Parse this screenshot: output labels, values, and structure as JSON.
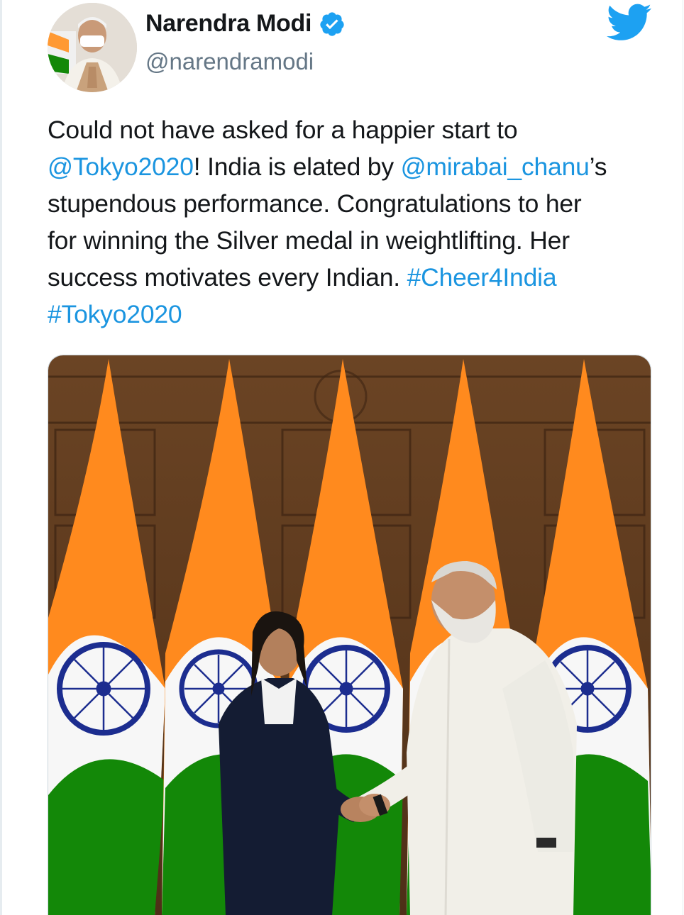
{
  "author": {
    "name": "Narendra Modi",
    "handle": "@narendramodi"
  },
  "icons": {
    "verified": "verified-badge-icon",
    "brand": "twitter-bird-icon"
  },
  "tweet": {
    "segments": [
      {
        "text": "Could not have asked for a happier start to",
        "type": "text",
        "line": 1
      },
      {
        "text": "@Tokyo2020",
        "type": "mention",
        "line": 2
      },
      {
        "text": "! India is elated by ",
        "type": "text",
        "line": 2
      },
      {
        "text": "@mirabai_chanu",
        "type": "mention",
        "line": 2
      },
      {
        "text": "’s",
        "type": "text",
        "line": 2
      },
      {
        "text": "stupendous performance. Congratulations to her",
        "type": "text",
        "line": 3
      },
      {
        "text": "for winning the Silver medal in weightlifting. Her",
        "type": "text",
        "line": 4
      },
      {
        "text": "success motivates every Indian. ",
        "type": "text",
        "line": 5
      },
      {
        "text": "#Cheer4India",
        "type": "hashtag",
        "line": 5
      },
      {
        "text": "#Tokyo2020",
        "type": "hashtag",
        "line": 6
      }
    ]
  },
  "colors": {
    "link": "#1b95e0",
    "text": "#14171a",
    "secondary": "#657786",
    "saffron": "#ff8a1e",
    "green": "#138808",
    "chakra": "#1c2d8f"
  }
}
